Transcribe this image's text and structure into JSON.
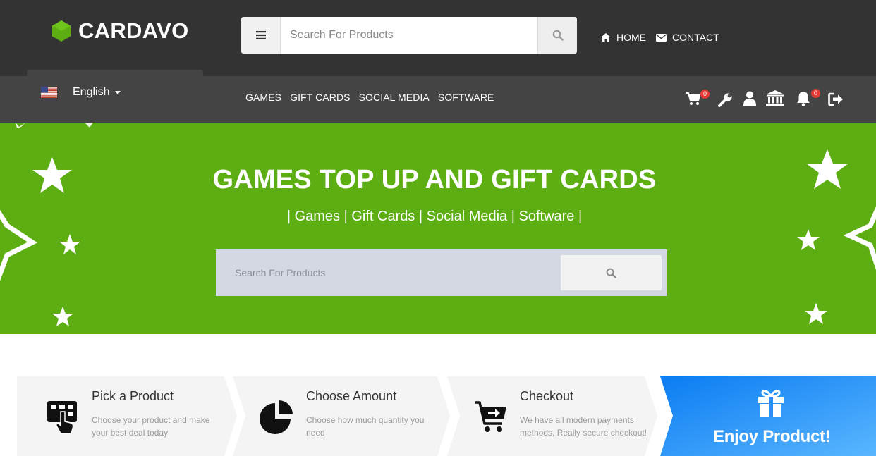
{
  "brand": {
    "name": "CARDAVO",
    "logo_color": "#5cae13"
  },
  "header": {
    "search_placeholder": "Search For Products",
    "menu_icon": "hamburger-icon",
    "search_icon": "search-icon",
    "links": [
      {
        "label": "HOME",
        "icon": "home-icon"
      },
      {
        "label": "CONTACT",
        "icon": "envelope-icon"
      }
    ]
  },
  "nav": {
    "language": {
      "label": "English",
      "flag": "us-flag-icon"
    },
    "links": [
      "GAMES",
      "GIFT CARDS",
      "SOCIAL MEDIA",
      "SOFTWARE"
    ],
    "icons": [
      {
        "name": "cart-icon",
        "badge": "0"
      },
      {
        "name": "wrench-icon"
      },
      {
        "name": "user-icon"
      },
      {
        "name": "bank-icon"
      },
      {
        "name": "bell-icon",
        "badge": "0"
      },
      {
        "name": "logout-icon"
      }
    ]
  },
  "hero": {
    "title": "GAMES TOP UP AND GIFT CARDS",
    "subtitle": "| Games | Gift Cards | Social Media | Software |",
    "search_placeholder": "Search For Products",
    "background": "#5cae13"
  },
  "steps": [
    {
      "title": "Pick a Product",
      "description": "Choose your product and make your best deal today",
      "icon": "tap-pick-icon"
    },
    {
      "title": "Choose Amount",
      "description": "Choose how much quantity you need",
      "icon": "pie-chart-icon"
    },
    {
      "title": "Checkout",
      "description": "We have all modern payments methods, Really secure checkout!",
      "icon": "cart-checkout-icon"
    },
    {
      "title": "Enjoy Product!",
      "icon": "gift-icon"
    }
  ]
}
